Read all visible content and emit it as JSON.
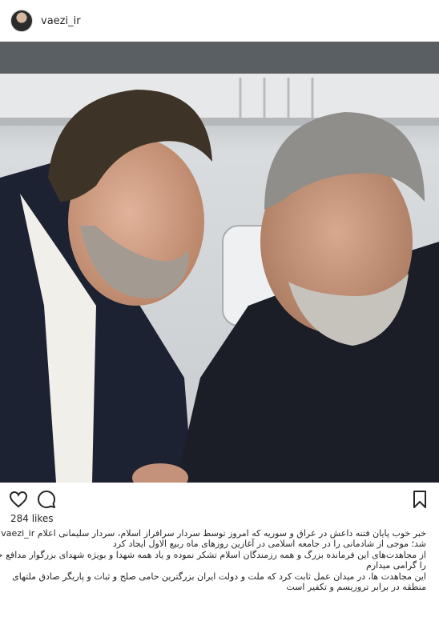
{
  "post": {
    "username": "vaezi_ir",
    "likes": "284 likes"
  },
  "caption": {
    "username": "vaezi_ir",
    "lines": [
      "خبر خوب پایان فتنه داعش در عراق و سوریه که امروز توسط سردار سرافراز اسلام، سردار سلیمانی اعلام",
      "شد؛ موجی از شادمانی را در جامعه اسلامی در آغازین روزهای ماه ربیع الاول ایجاد کرد",
      "از مجاهدت‌های این فرمانده بزرگ و همه رزمندگان اسلام تشکر نموده و یاد همه شهدا و بویژه شهدای بزرگوار مدافع حرم",
      "را گرامی میدارم",
      "این مجاهدت ها، در میدان عمل ثابت کرد که ملت و دولت ایران بزرگترین حامی صلح و ثبات و پاریگر صادق ملتهای",
      "منطقه در برابر تروریسم و تکفیر است"
    ]
  },
  "icons": {
    "like": "heart-icon",
    "comment": "comment-icon",
    "save": "bookmark-icon"
  }
}
